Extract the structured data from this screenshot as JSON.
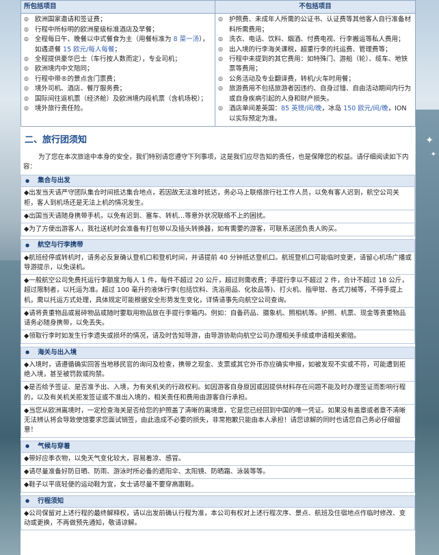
{
  "table": {
    "included_header": "所包括项目",
    "excluded_header": "不包括项目",
    "included": [
      {
        "parts": [
          {
            "t": "欧洲国家邀请和签证费；"
          }
        ]
      },
      {
        "parts": [
          {
            "t": "行程中所标明的欧洲星级标准酒店及早餐；"
          }
        ]
      },
      {
        "parts": [
          {
            "t": "全程每日午、晚餐以中式餐食为主（用餐标准为 "
          },
          {
            "t": "8 菜一汤",
            "c": "blue"
          },
          {
            "t": "），如遇退餐 "
          },
          {
            "t": "15 欧元/每人每餐",
            "c": "blue"
          },
          {
            "t": "；"
          }
        ]
      },
      {
        "parts": [
          {
            "t": "全程提供豪华巴士（车行按人数而定），专业司机；"
          }
        ]
      },
      {
        "parts": [
          {
            "t": "欧洲境内中文陪同；"
          }
        ]
      },
      {
        "parts": [
          {
            "t": "行程中带®的景点含门票费；"
          }
        ]
      },
      {
        "parts": [
          {
            "t": "境外司机、酒店、餐厅服务费；"
          }
        ]
      },
      {
        "parts": [
          {
            "t": "国际间往返机票（经济舱）及欧洲境内段机票（含机场税）；"
          }
        ]
      },
      {
        "parts": [
          {
            "t": "境外旅行责任险。"
          }
        ]
      }
    ],
    "excluded": [
      {
        "parts": [
          {
            "t": "护照费、未成年人所需的公证书、认证费等其他客人自行准备材料所需费用；"
          }
        ]
      },
      {
        "parts": [
          {
            "t": "洗衣、电话、饮料、烟酒、付费电视、行李搬运等私人费用；"
          }
        ]
      },
      {
        "parts": [
          {
            "t": "出入境的行李海关课税，超重行李的托运费、管理费等；"
          }
        ]
      },
      {
        "parts": [
          {
            "t": "行程中未提到的其它费用：如特殊门、游船（轮）、缆车、地铁票等费用；"
          }
        ]
      },
      {
        "parts": [
          {
            "t": "公务活动及专业翻译费，转机/火车时用餐；"
          }
        ]
      },
      {
        "parts": [
          {
            "t": "旅游费用不包括旅游者因违约、自身过错、自由活动期间内行为或自身疾病引起的人身和财产损失。"
          }
        ]
      },
      {
        "parts": [
          {
            "t": "酒店单间差英国："
          },
          {
            "t": "85 英镑/间/晚",
            "c": "blue"
          },
          {
            "t": "，冰岛 "
          },
          {
            "t": "150 欧元/间/晚",
            "c": "blue"
          },
          {
            "t": "，ION 以实际预定为准。"
          }
        ]
      }
    ]
  },
  "section_title": "二、旅行团须知",
  "intro": "为了您在本次旅途中本身的安全，我们特别请您遵守下列事项，这是我们应尽告知的责任，也是保障您的权益。请仔细阅读如下内容：",
  "groups": [
    {
      "title": "集合与出发",
      "items": [
        "◆出发当天请严守团队集合时间抵达集合地点，若因故无法准时抵达，务必马上联络旅行社工作人员，以免有客人迟到，航空公司关柜，客人到机场还是无法上机的情况发生。",
        "◆出国当天请随身携带手机，以免有迟到、塞车、转机…等意外状况联络不上的困扰。",
        "◆为了方便出游客人，我社送机时会准备有打包带以及插头转换器，如有需要的游客，可联系送团负责人购买。"
      ]
    },
    {
      "title": "航空与行李携带",
      "items": [
        "◆航班经停或转机时，请务必反复确认登机口和登机时间，并请提前 40 分钟抵达登机口。航班登机口可能临时变更，请留心机场广播或导游提示，以免误机。",
        "◆一般航空公司免费托运行李额度为每人 1 件，每件不超过 20 公斤，超过则需收费；手提行李以不超过 2 件，合计不超过 18 公斤，超过限制者，以托运为准。超过 100 毫升的液体行李(包括饮料、洗浴用品、化妆品等)、打火机、指甲钳、各式刀械等，不得手提上机，需以托运方式处理，具体规定可能根据安全形势发生变化，详情请事先向航空公司查询。",
        "◆请将贵重物品或易碎物品或随时要取用物品放在手提行李箱内。例如：自备药品、摄象机、照相机等。护照、机票、现金等贵重物品请务必随身携带，以免丢失。",
        "◆领取行李时如发生行李遗失或损坏的情况，请及时告知导游，由导游协助向航空公司办理相关手续或申请相关索赔。"
      ]
    },
    {
      "title": "海关与出入境",
      "items": [
        "◆入境时，请遵循确实回答当地移民官的询问及检查，携带之现金、支票或其它外币亦应确实申报，如被发现不实或不符，可能遭到拒绝入境，甚至被罚款或拘禁。",
        "◆是否给予签证、是否准予出、入境，为有关机关的行政权利。如因游客自身原因或因提供材料存在问题不能及时办理签证而影响行程的，以及有关机关拒发签证或不准出入境的，相关责任和费用由游客自行承担。",
        "◆当您从欧洲离境时，一定检查海关是否给您的护照盖了清晰的离境章，它是您已经回到中国的唯一凭证。如果没有盖章或者章不清晰无法辨认将会导致使馆要求您面试销签，由此造成不必要的损失，非常抱歉只能由本人承担！请您谅解的同时也请您自己务必仔细留意！"
      ]
    },
    {
      "title": "气候与穿着",
      "items": [
        "◆带好应季衣物，以免天气变化较大，容易着凉、感冒。",
        "◆请尽量准备好防日晒、防雨、游泳时所必备的遮阳伞、太阳镜、防晒霜、泳装等等。",
        "◆鞋子以平底轻便的运动鞋为宜，女士请尽量不要穿高跟鞋。"
      ]
    },
    {
      "title": "行程须知",
      "items": [
        "◆公司保留对上述行程的最终解释权，请以出发前确认行程为准，本公司有权对上述行程次序、景点、航班及住宿地点作临时修改、变动或更换，不再做预先通知，敬请谅解。"
      ]
    }
  ],
  "icons": {
    "bullet": "circle-bullet-icon",
    "sparkle": "sparkle-icon"
  }
}
